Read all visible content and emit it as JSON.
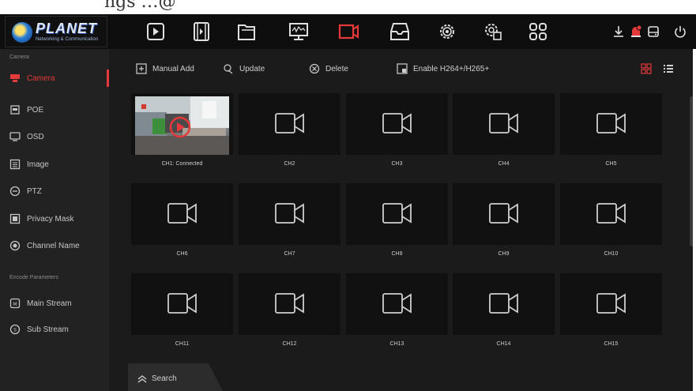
{
  "page": {
    "cut_title": "ngs …@"
  },
  "header": {
    "brand": {
      "name": "PLANET",
      "tagline": "Networking & Communication"
    },
    "nav": [
      {
        "key": "playback",
        "icon": "play-icon"
      },
      {
        "key": "film",
        "icon": "film-icon"
      },
      {
        "key": "files",
        "icon": "folder-icon"
      },
      {
        "key": "monitor",
        "icon": "monitor-icon"
      },
      {
        "key": "camera",
        "icon": "camera-icon",
        "active": true
      },
      {
        "key": "storage",
        "icon": "storage-icon"
      },
      {
        "key": "settings",
        "icon": "gear-icon"
      },
      {
        "key": "system",
        "icon": "system-gear-icon"
      },
      {
        "key": "apps",
        "icon": "grid-icon"
      }
    ],
    "right": [
      {
        "key": "download",
        "icon": "download-icon"
      },
      {
        "key": "alarm",
        "icon": "alarm-icon"
      },
      {
        "key": "hdd",
        "icon": "hdd-icon"
      },
      {
        "key": "power",
        "icon": "power-icon"
      }
    ]
  },
  "sidebar": {
    "section_camera": "Camera",
    "section_encode": "Encode Parameters",
    "items": [
      {
        "label": "Camera",
        "icon": "camera-icon",
        "active": true
      },
      {
        "label": "POE",
        "icon": "poe-icon"
      },
      {
        "label": "OSD",
        "icon": "osd-icon"
      },
      {
        "label": "Image",
        "icon": "image-icon"
      },
      {
        "label": "PTZ",
        "icon": "ptz-icon"
      },
      {
        "label": "Privacy Mask",
        "icon": "privacy-mask-icon"
      },
      {
        "label": "Channel Name",
        "icon": "channel-name-icon"
      },
      {
        "label": "Main Stream",
        "icon": "main-stream-icon"
      },
      {
        "label": "Sub Stream",
        "icon": "sub-stream-icon"
      }
    ]
  },
  "toolbar": {
    "manual_add": "Manual Add",
    "update": "Update",
    "delete": "Delete",
    "enable_h264": "Enable H264+/H265+"
  },
  "channels": [
    "CH1: Connected",
    "CH2",
    "CH3",
    "CH4",
    "CH5",
    "CH6",
    "CH7",
    "CH8",
    "CH9",
    "CH10",
    "CH11",
    "CH12",
    "CH13",
    "CH14",
    "CH15"
  ],
  "search": {
    "label": "Search"
  },
  "colors": {
    "accent": "#e5393a",
    "background": "#1b1b1b",
    "sidebar": "#222222",
    "tile": "#111111"
  }
}
